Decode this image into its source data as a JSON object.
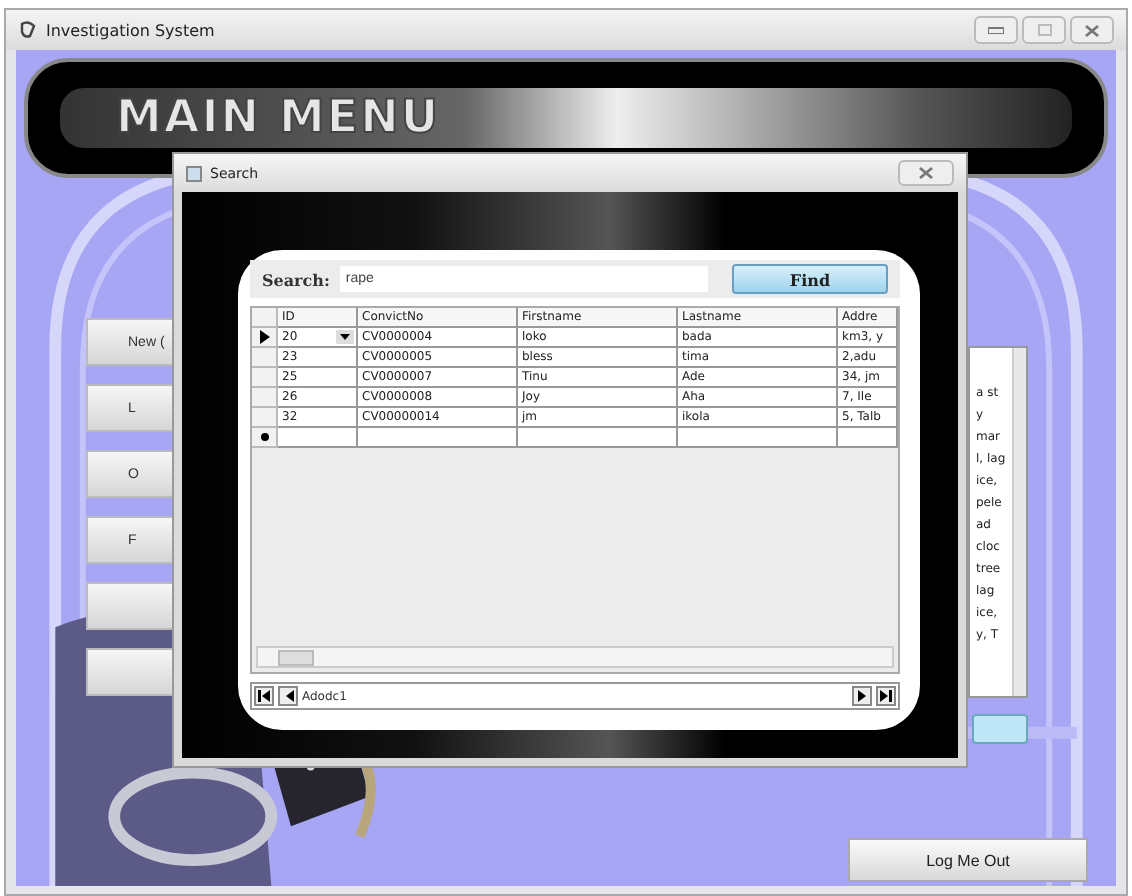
{
  "window": {
    "title": "Investigation System"
  },
  "banner": {
    "title": "MAIN MENU"
  },
  "menu_buttons": [
    {
      "kind": "text",
      "label": "New ("
    },
    {
      "kind": "text",
      "label": "L"
    },
    {
      "kind": "text",
      "label": "O"
    },
    {
      "kind": "text",
      "label": "F"
    },
    {
      "kind": "blank"
    },
    {
      "kind": "blank"
    }
  ],
  "side_text": [
    "a st",
    "y",
    "mar",
    "l, lag",
    "ice,",
    "pele",
    "ad",
    "cloc",
    "tree",
    "lag",
    "ice,",
    "y, T"
  ],
  "logout_button": "Log Me Out",
  "dialog": {
    "title": "Search",
    "search_label": "Search:",
    "query": "rape",
    "find_button": "Find",
    "columns": [
      "ID",
      "ConvictNo",
      "Firstname",
      "Lastname",
      "Addre"
    ],
    "rows": [
      {
        "selected": true,
        "cells": [
          "20",
          "CV0000004",
          "loko",
          "bada",
          "km3, y"
        ]
      },
      {
        "selected": false,
        "cells": [
          "23",
          "CV0000005",
          "bless",
          "tima",
          "2,adu"
        ]
      },
      {
        "selected": false,
        "cells": [
          "25",
          "CV0000007",
          "Tinu",
          "Ade",
          "34, jm"
        ]
      },
      {
        "selected": false,
        "cells": [
          "26",
          "CV0000008",
          "Joy",
          "Aha",
          "7, Ile"
        ]
      },
      {
        "selected": false,
        "cells": [
          "32",
          "CV00000014",
          "jm",
          "ikola",
          "5, Talb"
        ]
      }
    ],
    "navigator_caption": "Adodc1"
  }
}
